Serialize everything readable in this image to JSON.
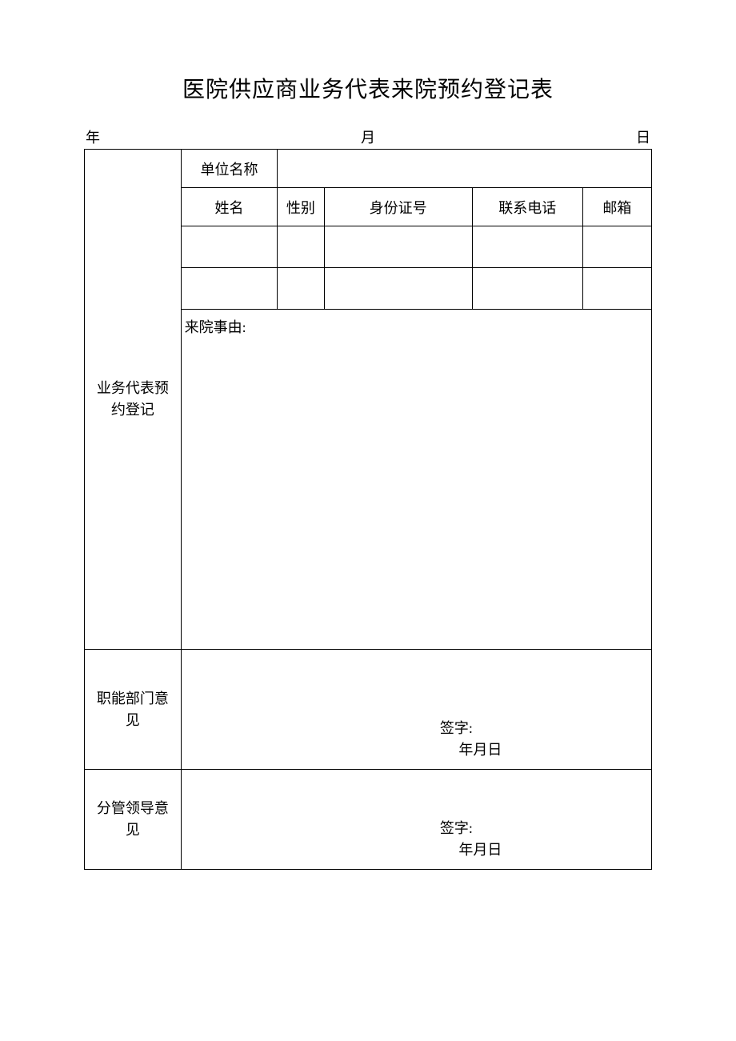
{
  "title": "医院供应商业务代表来院预约登记表",
  "date": {
    "year_label": "年",
    "month_label": "月",
    "day_label": "日"
  },
  "sections": {
    "registration": {
      "side_label": "业务代表预约登记",
      "unit_name_label": "单位名称",
      "headers": {
        "name": "姓名",
        "gender": "性别",
        "id_number": "身份证号",
        "phone": "联系电话",
        "email": "邮箱"
      },
      "reason_label": "来院事由:"
    },
    "dept_opinion": {
      "side_label": "职能部门意见",
      "sign_label": "签字:",
      "date_label": "年月日"
    },
    "leader_opinion": {
      "side_label": "分管领导意见",
      "sign_label": "签字:",
      "date_label": "年月日"
    }
  }
}
